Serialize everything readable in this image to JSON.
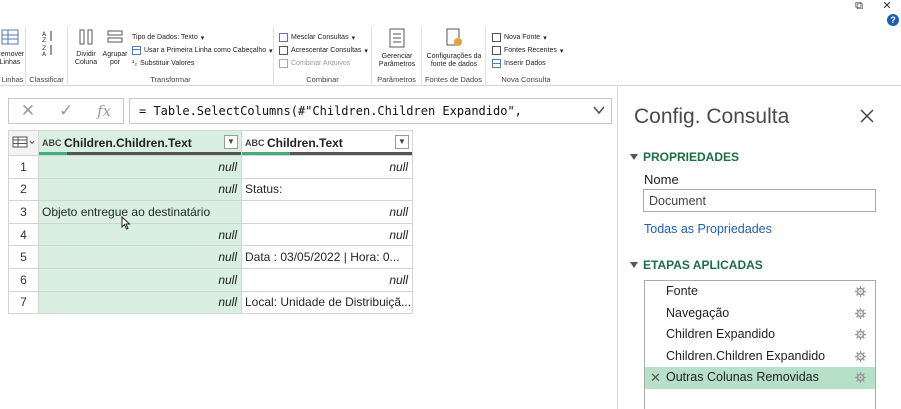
{
  "window": {
    "restore_glyph": "⧉",
    "close_glyph": "✕",
    "help_glyph": "?"
  },
  "ribbon": {
    "groups": {
      "linhas": {
        "label": "Linhas",
        "button": "Remover Linhas"
      },
      "classificar": {
        "label": "Classificar"
      },
      "transformar": {
        "label": "Transformar",
        "dividir": "Dividir Coluna",
        "agrupar": "Agrupar por",
        "tipo": "Tipo de Dados: Texto",
        "primeira": "Usar a Primeira Linha como Cabeçalho",
        "substituir": "Substituir Valores"
      },
      "combinar": {
        "label": "Combinar",
        "mesclar": "Mesclar Consultas",
        "acrescentar": "Acrescentar Consultas",
        "arquivos": "Combinar Arquivos"
      },
      "parametros": {
        "label": "Parâmetros",
        "gerenciar": "Gerenciar Parâmetros"
      },
      "fontes": {
        "label": "Fontes de Dados",
        "config": "Configurações da fonte de dados"
      },
      "nova": {
        "label": "Nova Consulta",
        "nova_fonte": "Nova Fonte",
        "recentes": "Fontes Recentes",
        "inserir": "Inserir Dados"
      }
    }
  },
  "formula_bar": {
    "cancel_glyph": "✕",
    "confirm_glyph": "✓",
    "fx_glyph": "fx",
    "formula": "= Table.SelectColumns(#\"Children.Children Expandido\","
  },
  "grid": {
    "columns": [
      {
        "type": "ABC",
        "name": "Children.Children.Text"
      },
      {
        "type": "ABC",
        "name": "Children.Text"
      }
    ],
    "rows": [
      {
        "n": "1",
        "c1": "null",
        "c1_null": true,
        "c2": "null",
        "c2_null": true
      },
      {
        "n": "2",
        "c1": "null",
        "c1_null": true,
        "c2": "Status:",
        "c2_null": false
      },
      {
        "n": "3",
        "c1": "Objeto entregue ao destinatário",
        "c1_null": false,
        "c2": "null",
        "c2_null": true
      },
      {
        "n": "4",
        "c1": "null",
        "c1_null": true,
        "c2": "null",
        "c2_null": true
      },
      {
        "n": "5",
        "c1": "null",
        "c1_null": true,
        "c2": "Data  : 03/05/2022 | Hora: 0...",
        "c2_null": false
      },
      {
        "n": "6",
        "c1": "null",
        "c1_null": true,
        "c2": "null",
        "c2_null": true
      },
      {
        "n": "7",
        "c1": "null",
        "c1_null": true,
        "c2": "Local: Unidade de Distribuiçã...",
        "c2_null": false
      }
    ]
  },
  "pane": {
    "title": "Config. Consulta",
    "propriedades": "PROPRIEDADES",
    "nome_label": "Nome",
    "nome_value": "Document",
    "todas": "Todas as Propriedades",
    "etapas": "ETAPAS APLICADAS",
    "steps": [
      {
        "label": "Fonte",
        "active": false
      },
      {
        "label": "Navegação",
        "active": false
      },
      {
        "label": "Children Expandido",
        "active": false
      },
      {
        "label": "Children.Children Expandido",
        "active": false
      },
      {
        "label": "Outras Colunas Removidas",
        "active": true
      }
    ]
  },
  "colors": {
    "accent_green": "#1e6e45",
    "selected_column": "#d9efe2",
    "active_step": "#b6e0c7",
    "link": "#1f5fb4"
  }
}
